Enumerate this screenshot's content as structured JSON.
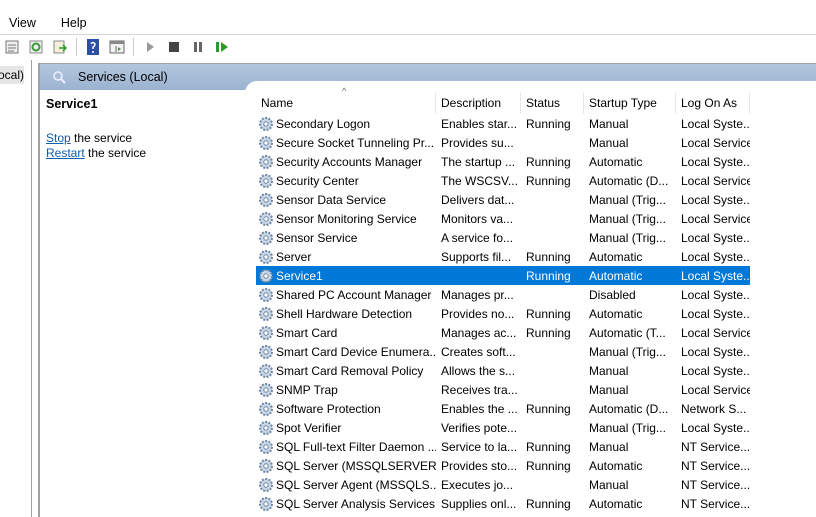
{
  "menu": [
    "View",
    "Help"
  ],
  "tree": {
    "selected": "Services (Local)"
  },
  "panel": {
    "title": "Services (Local)"
  },
  "detail": {
    "service_name": "Service1",
    "stop_link": "Stop",
    "stop_text": " the service",
    "restart_link": "Restart",
    "restart_text": " the service"
  },
  "columns": [
    "Name",
    "Description",
    "Status",
    "Startup Type",
    "Log On As"
  ],
  "rows": [
    [
      "Secondary Logon",
      "Enables star...",
      "Running",
      "Manual",
      "Local Syste..."
    ],
    [
      "Secure Socket Tunneling Pr...",
      "Provides su...",
      "",
      "Manual",
      "Local Service"
    ],
    [
      "Security Accounts Manager",
      "The startup ...",
      "Running",
      "Automatic",
      "Local Syste..."
    ],
    [
      "Security Center",
      "The WSCSV...",
      "Running",
      "Automatic (D...",
      "Local Service"
    ],
    [
      "Sensor Data Service",
      "Delivers dat...",
      "",
      "Manual (Trig...",
      "Local Syste..."
    ],
    [
      "Sensor Monitoring Service",
      "Monitors va...",
      "",
      "Manual (Trig...",
      "Local Service"
    ],
    [
      "Sensor Service",
      "A service fo...",
      "",
      "Manual (Trig...",
      "Local Syste..."
    ],
    [
      "Server",
      "Supports fil...",
      "Running",
      "Automatic",
      "Local Syste..."
    ],
    [
      "Service1",
      "",
      "Running",
      "Automatic",
      "Local Syste..."
    ],
    [
      "Shared PC Account Manager",
      "Manages pr...",
      "",
      "Disabled",
      "Local Syste..."
    ],
    [
      "Shell Hardware Detection",
      "Provides no...",
      "Running",
      "Automatic",
      "Local Syste..."
    ],
    [
      "Smart Card",
      "Manages ac...",
      "Running",
      "Automatic (T...",
      "Local Service"
    ],
    [
      "Smart Card Device Enumera...",
      "Creates soft...",
      "",
      "Manual (Trig...",
      "Local Syste..."
    ],
    [
      "Smart Card Removal Policy",
      "Allows the s...",
      "",
      "Manual",
      "Local Syste..."
    ],
    [
      "SNMP Trap",
      "Receives tra...",
      "",
      "Manual",
      "Local Service"
    ],
    [
      "Software Protection",
      "Enables the ...",
      "Running",
      "Automatic (D...",
      "Network S..."
    ],
    [
      "Spot Verifier",
      "Verifies pote...",
      "",
      "Manual (Trig...",
      "Local Syste..."
    ],
    [
      "SQL Full-text Filter Daemon ...",
      "Service to la...",
      "Running",
      "Manual",
      "NT Service..."
    ],
    [
      "SQL Server (MSSQLSERVER)",
      "Provides sto...",
      "Running",
      "Automatic",
      "NT Service..."
    ],
    [
      "SQL Server Agent (MSSQLS...",
      "Executes jo...",
      "",
      "Manual",
      "NT Service..."
    ],
    [
      "SQL Server Analysis Services...",
      "Supplies onl...",
      "Running",
      "Automatic",
      "NT Service..."
    ]
  ],
  "selected_row": 8
}
